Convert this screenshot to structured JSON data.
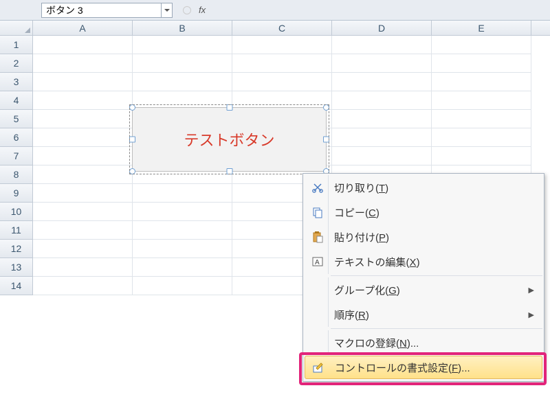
{
  "formula_bar": {
    "name_box_value": "ボタン 3",
    "fx_label": "fx"
  },
  "columns": [
    "A",
    "B",
    "C",
    "D",
    "E"
  ],
  "rows": [
    "1",
    "2",
    "3",
    "4",
    "5",
    "6",
    "7",
    "8",
    "9",
    "10",
    "11",
    "12",
    "13",
    "14"
  ],
  "button_shape": {
    "label": "テストボタン"
  },
  "context_menu": {
    "cut": "切り取り(T)",
    "copy": "コピー(C)",
    "paste": "貼り付け(P)",
    "edit_text": "テキストの編集(X)",
    "grouping": "グループ化(G)",
    "order": "順序(R)",
    "assign_macro": "マクロの登録(N)...",
    "format_control": "コントロールの書式設定(F)..."
  }
}
